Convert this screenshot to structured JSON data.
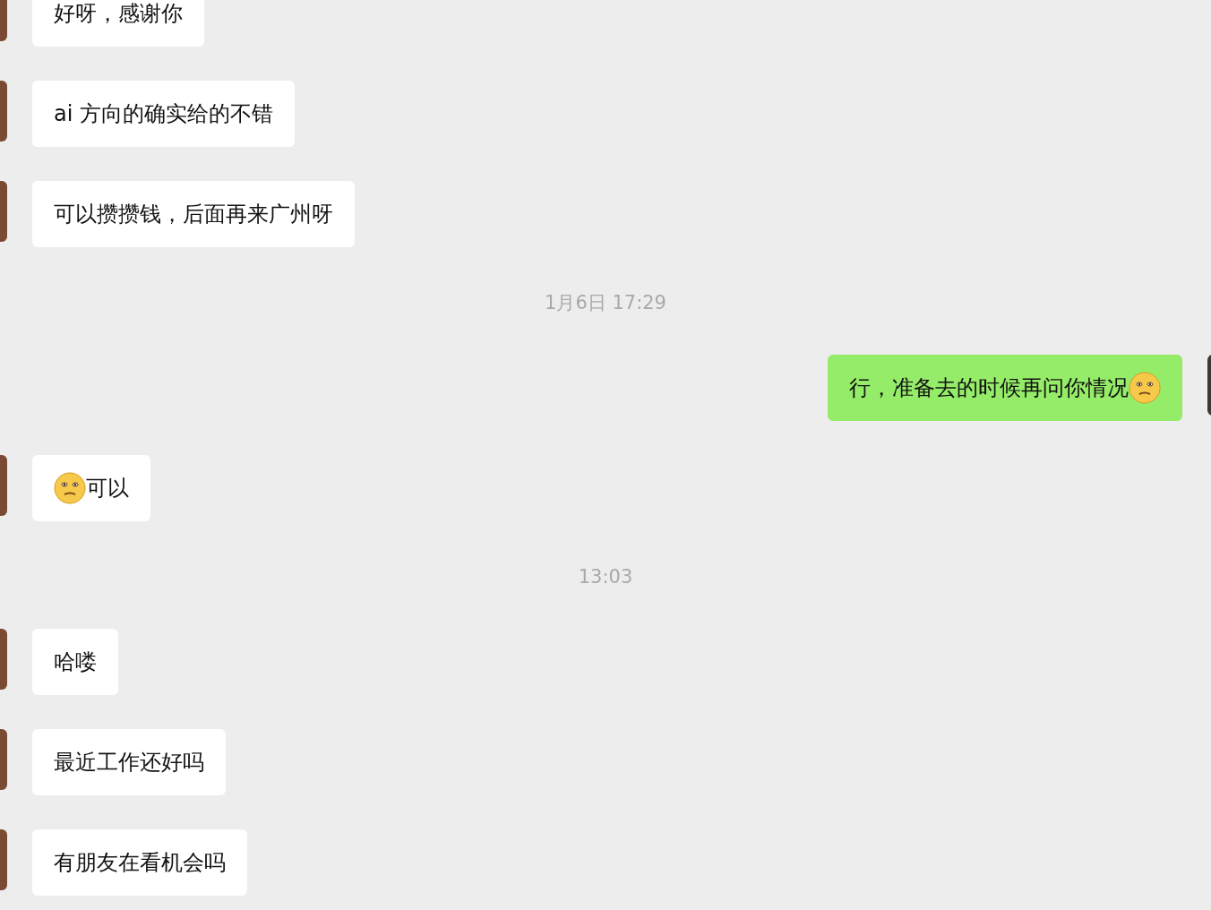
{
  "messages": [
    {
      "kind": "message",
      "sent": false,
      "text": "好呀，感谢你",
      "emoji_before": false,
      "emoji_after": false
    },
    {
      "kind": "message",
      "sent": false,
      "text": "ai 方向的确实给的不错",
      "emoji_before": false,
      "emoji_after": false
    },
    {
      "kind": "message",
      "sent": false,
      "text": "可以攒攒钱，后面再来广州呀",
      "emoji_before": false,
      "emoji_after": false
    },
    {
      "kind": "time",
      "text": "1月6日 17:29"
    },
    {
      "kind": "message",
      "sent": true,
      "text": "行，准备去的时候再问你情况",
      "emoji_before": false,
      "emoji_after": true
    },
    {
      "kind": "message",
      "sent": false,
      "text": "可以",
      "emoji_before": true,
      "emoji_after": false
    },
    {
      "kind": "time",
      "text": "13:03"
    },
    {
      "kind": "message",
      "sent": false,
      "text": "哈喽",
      "emoji_before": false,
      "emoji_after": false
    },
    {
      "kind": "message",
      "sent": false,
      "text": "最近工作还好吗",
      "emoji_before": false,
      "emoji_after": false
    },
    {
      "kind": "message",
      "sent": false,
      "text": "有朋友在看机会吗",
      "emoji_before": false,
      "emoji_after": false
    }
  ]
}
